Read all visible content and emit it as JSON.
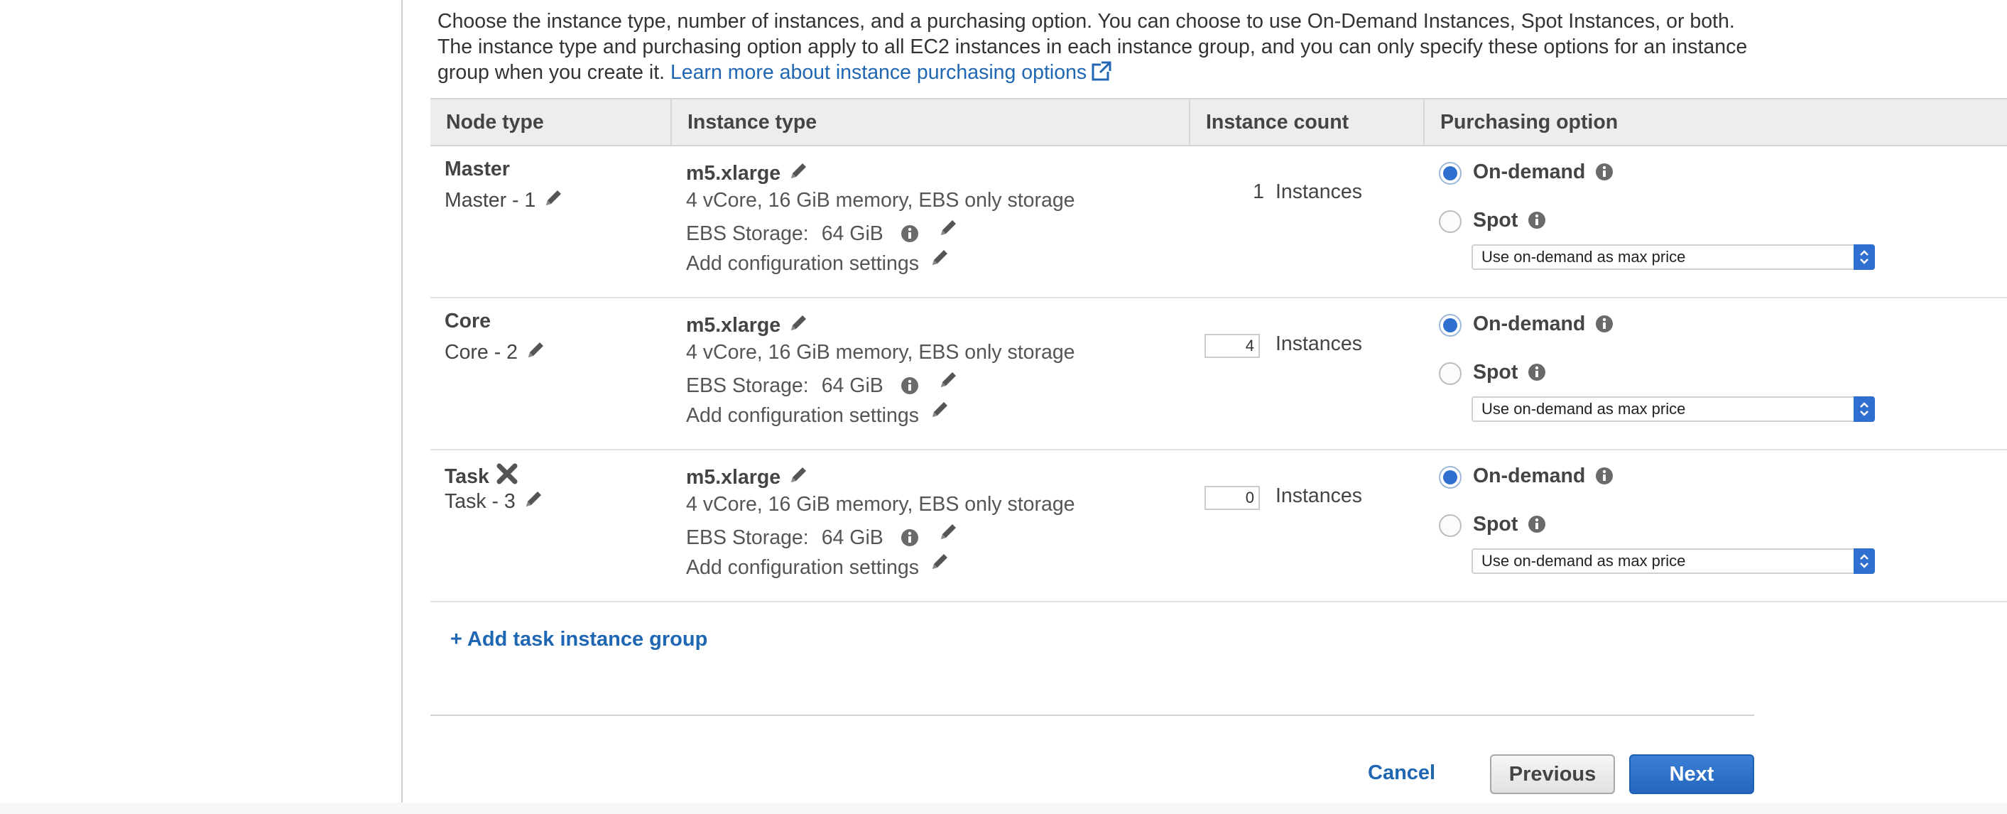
{
  "intro": {
    "text": "Choose the instance type, number of instances, and a purchasing option. You can choose to use On-Demand Instances, Spot Instances, or both. The instance type and purchasing option apply to all EC2 instances in each instance group, and you can only specify these options for an instance group when you create it.",
    "link": "Learn more about instance purchasing options"
  },
  "table": {
    "headers": {
      "node_type": "Node type",
      "instance_type": "Instance type",
      "instance_count": "Instance count",
      "purchasing_option": "Purchasing option"
    },
    "rows": [
      {
        "node_type": "Master",
        "name": "Master - 1",
        "instance_type": "m5.xlarge",
        "desc": "4 vCore, 16 GiB memory, EBS only storage",
        "ebs_label": "EBS Storage:",
        "ebs_value": "64 GiB",
        "add_config": "Add configuration settings",
        "count": "1",
        "count_label": "Instances",
        "on_demand": "On-demand",
        "spot": "Spot",
        "selected": "On-demand",
        "max_price": "Use on-demand as max price",
        "removable": false,
        "count_editable": false
      },
      {
        "node_type": "Core",
        "name": "Core - 2",
        "instance_type": "m5.xlarge",
        "desc": "4 vCore, 16 GiB memory, EBS only storage",
        "ebs_label": "EBS Storage:",
        "ebs_value": "64 GiB",
        "add_config": "Add configuration settings",
        "count": "4",
        "count_label": "Instances",
        "on_demand": "On-demand",
        "spot": "Spot",
        "selected": "On-demand",
        "max_price": "Use on-demand as max price",
        "removable": false,
        "count_editable": true
      },
      {
        "node_type": "Task",
        "name": "Task - 3",
        "instance_type": "m5.xlarge",
        "desc": "4 vCore, 16 GiB memory, EBS only storage",
        "ebs_label": "EBS Storage:",
        "ebs_value": "64 GiB",
        "add_config": "Add configuration settings",
        "count": "0",
        "count_label": "Instances",
        "on_demand": "On-demand",
        "spot": "Spot",
        "selected": "On-demand",
        "max_price": "Use on-demand as max price",
        "removable": true,
        "count_editable": true
      }
    ]
  },
  "add_task_group": "+ Add task instance group",
  "footer": {
    "cancel": "Cancel",
    "previous": "Previous",
    "next": "Next"
  },
  "colors": {
    "link": "#1f66b3",
    "primary_button": "#2565bf",
    "radio_selected": "#2f6fcf"
  }
}
